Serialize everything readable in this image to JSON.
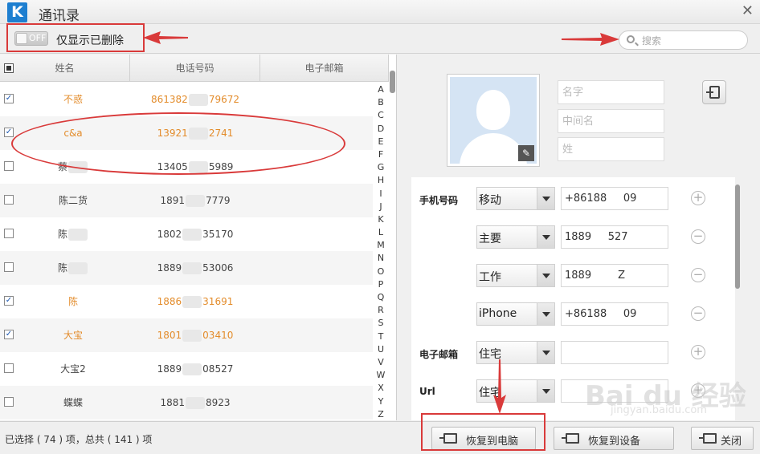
{
  "window": {
    "logo": "K",
    "title": "通讯录"
  },
  "toolbar": {
    "toggle_state": "OFF",
    "show_deleted_label": "仅显示已删除",
    "search_placeholder": "搜索"
  },
  "table": {
    "headers": {
      "name": "姓名",
      "phone": "电话号码",
      "email": "电子邮箱"
    },
    "rows": [
      {
        "name_a": "不惑",
        "name_b": "",
        "phone_a": "861382",
        "phone_b": "79672",
        "checked": "✓",
        "orange": true
      },
      {
        "name_a": "c&a",
        "name_b": "",
        "phone_a": "13921",
        "phone_b": "2741",
        "checked": "✓",
        "orange": true
      },
      {
        "name_a": "蔡",
        "name_b": "",
        "phone_a": "13405",
        "phone_b": "5989",
        "checked": "",
        "orange": false
      },
      {
        "name_a": "陈二货",
        "name_b": "",
        "phone_a": "1891",
        "phone_b": "7779",
        "checked": "",
        "orange": false
      },
      {
        "name_a": "陈",
        "name_b": "",
        "phone_a": "1802",
        "phone_b": "35170",
        "checked": "",
        "orange": false
      },
      {
        "name_a": "陈",
        "name_b": "",
        "phone_a": "1889",
        "phone_b": "53006",
        "checked": "",
        "orange": false
      },
      {
        "name_a": "陈",
        "name_b": "",
        "phone_a": "1886",
        "phone_b": "31691",
        "checked": "✓",
        "orange": true
      },
      {
        "name_a": "大宝",
        "name_b": "",
        "phone_a": "1801",
        "phone_b": "03410",
        "checked": "✓",
        "orange": true
      },
      {
        "name_a": "大宝2",
        "name_b": "",
        "phone_a": "1889",
        "phone_b": "08527",
        "checked": "",
        "orange": false
      },
      {
        "name_a": "蝶蝶",
        "name_b": "",
        "phone_a": "1881",
        "phone_b": "8923",
        "checked": "",
        "orange": false
      }
    ]
  },
  "alphabet": [
    "A",
    "B",
    "C",
    "D",
    "E",
    "F",
    "G",
    "H",
    "I",
    "J",
    "K",
    "L",
    "M",
    "N",
    "O",
    "P",
    "Q",
    "R",
    "S",
    "T",
    "U",
    "V",
    "W",
    "X",
    "Y",
    "Z"
  ],
  "detail": {
    "first_name_placeholder": "名字",
    "middle_name_placeholder": "中间名",
    "last_name_placeholder": "姓",
    "phone_label": "手机号码",
    "email_label": "电子邮箱",
    "url_label": "Url",
    "phones": [
      {
        "type": "移动",
        "value": "+86188     09",
        "action": "+"
      },
      {
        "type": "主要",
        "value": "1889     527",
        "action": "−"
      },
      {
        "type": "工作",
        "value": "1889        Z",
        "action": "−"
      },
      {
        "type": "iPhone",
        "value": "+86188     09",
        "action": "−"
      }
    ],
    "email_type": "住宅",
    "email_action": "+",
    "url_type": "住宅",
    "url_action": "+"
  },
  "footer": {
    "status": "已选择 ( 74 ) 项，总共 ( 141 ) 项",
    "restore_pc": "恢复到电脑",
    "restore_device": "恢复到设备",
    "close": "关闭"
  },
  "watermark": {
    "logo": "Bai du 经验",
    "url": "jingyan.baidu.com"
  },
  "colors": {
    "accent_orange": "#e38c2b",
    "annotation_red": "#d93a3a",
    "logo_blue": "#1e7fd0"
  }
}
